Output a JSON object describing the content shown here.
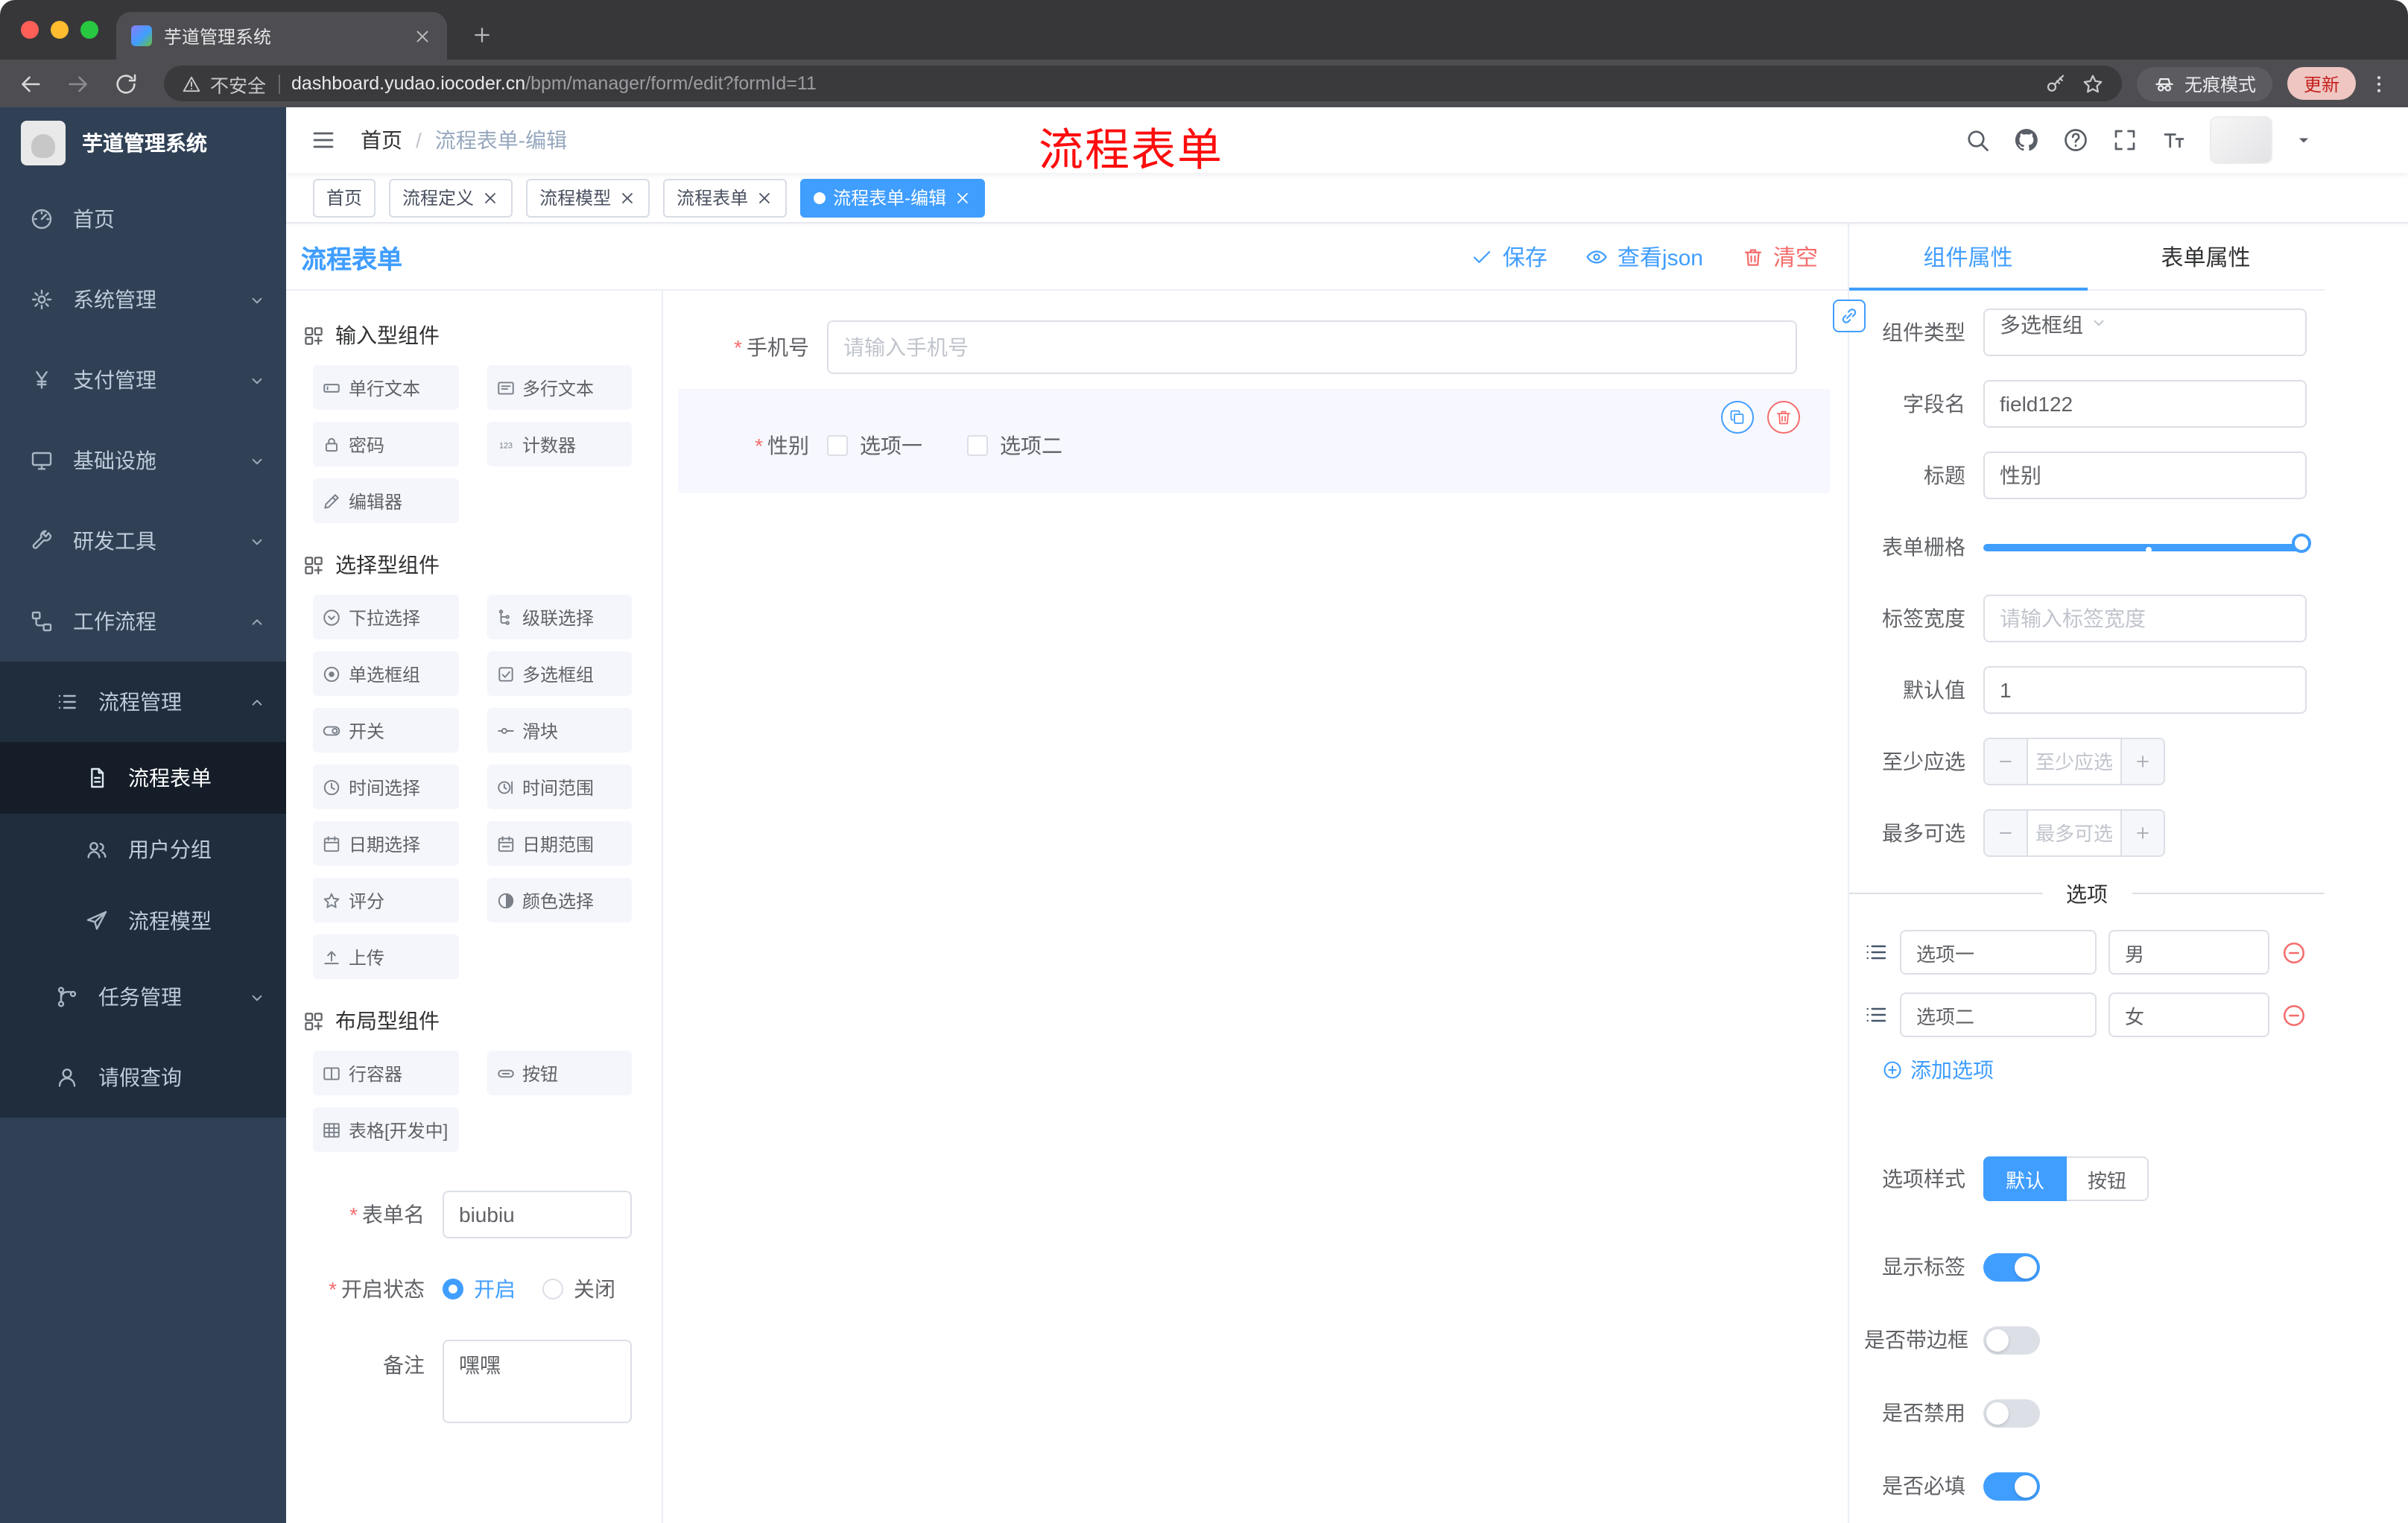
{
  "browser": {
    "tab_title": "芋道管理系统",
    "security_label": "不安全",
    "url_domain": "dashboard.yudao.iocoder.cn",
    "url_path": "/bpm/manager/form/edit?formId=11",
    "incognito_label": "无痕模式",
    "update_label": "更新"
  },
  "colors": {
    "accent": "#409eff",
    "danger": "#f56c6c",
    "sidebar_bg": "#304156",
    "annotation": "#fd0d0d"
  },
  "sidebar": {
    "logo_title": "芋道管理系统",
    "items": [
      {
        "id": "home",
        "label": "首页",
        "icon": "gauge",
        "level": 1
      },
      {
        "id": "system",
        "label": "系统管理",
        "icon": "gear",
        "level": 1,
        "chevron": "down"
      },
      {
        "id": "payment",
        "label": "支付管理",
        "icon": "yen",
        "level": 1,
        "chevron": "down"
      },
      {
        "id": "infra",
        "label": "基础设施",
        "icon": "monitor",
        "level": 1,
        "chevron": "down"
      },
      {
        "id": "devtools",
        "label": "研发工具",
        "icon": "tools",
        "level": 1,
        "chevron": "down"
      },
      {
        "id": "workflow",
        "label": "工作流程",
        "icon": "workflow",
        "level": 1,
        "chevron": "up"
      },
      {
        "id": "process-mgmt",
        "label": "流程管理",
        "icon": "list",
        "level": 2,
        "chevron": "up"
      },
      {
        "id": "process-form",
        "label": "流程表单",
        "icon": "doc",
        "level": 3,
        "active": true
      },
      {
        "id": "user-group",
        "label": "用户分组",
        "icon": "users",
        "level": 3
      },
      {
        "id": "process-model",
        "label": "流程模型",
        "icon": "send",
        "level": 3
      },
      {
        "id": "task-mgmt",
        "label": "任务管理",
        "icon": "branch",
        "level": 2,
        "chevron": "down"
      },
      {
        "id": "leave-query",
        "label": "请假查询",
        "icon": "user",
        "level": 2
      }
    ]
  },
  "header": {
    "breadcrumb_root": "首页",
    "breadcrumb_current": "流程表单-编辑",
    "annotation": "流程表单"
  },
  "tags": [
    {
      "label": "首页",
      "closable": false,
      "active": false
    },
    {
      "label": "流程定义",
      "closable": true,
      "active": false
    },
    {
      "label": "流程模型",
      "closable": true,
      "active": false
    },
    {
      "label": "流程表单",
      "closable": true,
      "active": false
    },
    {
      "label": "流程表单-编辑",
      "closable": true,
      "active": true
    }
  ],
  "designer": {
    "title": "流程表单",
    "actions": {
      "save": "保存",
      "view_json": "查看json",
      "clear": "清空"
    },
    "palette_sections": [
      {
        "title": "输入型组件",
        "items": [
          {
            "label": "单行文本",
            "icon": "input"
          },
          {
            "label": "多行文本",
            "icon": "textarea"
          },
          {
            "label": "密码",
            "icon": "lock"
          },
          {
            "label": "计数器",
            "icon": "counter"
          },
          {
            "label": "编辑器",
            "icon": "editor"
          }
        ]
      },
      {
        "title": "选择型组件",
        "items": [
          {
            "label": "下拉选择",
            "icon": "select"
          },
          {
            "label": "级联选择",
            "icon": "cascader"
          },
          {
            "label": "单选框组",
            "icon": "radio"
          },
          {
            "label": "多选框组",
            "icon": "checkbox"
          },
          {
            "label": "开关",
            "icon": "switch"
          },
          {
            "label": "滑块",
            "icon": "slider"
          },
          {
            "label": "时间选择",
            "icon": "time"
          },
          {
            "label": "时间范围",
            "icon": "time-range"
          },
          {
            "label": "日期选择",
            "icon": "date"
          },
          {
            "label": "日期范围",
            "icon": "date-range"
          },
          {
            "label": "评分",
            "icon": "rate"
          },
          {
            "label": "颜色选择",
            "icon": "color"
          },
          {
            "label": "上传",
            "icon": "upload"
          }
        ]
      },
      {
        "title": "布局型组件",
        "items": [
          {
            "label": "行容器",
            "icon": "row"
          },
          {
            "label": "按钮",
            "icon": "button"
          },
          {
            "label": "表格[开发中]",
            "icon": "table"
          }
        ]
      }
    ],
    "meta": {
      "name_label": "表单名",
      "name_value": "biubiu",
      "status_label": "开启状态",
      "status_on": "开启",
      "status_off": "关闭",
      "status_selected": "开启",
      "remark_label": "备注",
      "remark_value": "嘿嘿"
    },
    "canvas": {
      "phone_label": "手机号",
      "phone_placeholder": "请输入手机号",
      "gender_label": "性别",
      "gender_options": [
        "选项一",
        "选项二"
      ]
    }
  },
  "props": {
    "tab_component": "组件属性",
    "tab_form": "表单属性",
    "component_type_label": "组件类型",
    "component_type_value": "多选框组",
    "field_name_label": "字段名",
    "field_name_value": "field122",
    "title_label": "标题",
    "title_value": "性别",
    "grid_label": "表单栅格",
    "label_width_label": "标签宽度",
    "label_width_placeholder": "请输入标签宽度",
    "default_label": "默认值",
    "default_value": "1",
    "min_label": "至少应选",
    "min_placeholder": "至少应选",
    "max_label": "最多可选",
    "max_placeholder": "最多可选",
    "options_title": "选项",
    "options": [
      {
        "name": "选项一",
        "value": "男"
      },
      {
        "name": "选项二",
        "value": "女"
      }
    ],
    "add_option_label": "添加选项",
    "style_label": "选项样式",
    "style_default": "默认",
    "style_button": "按钮",
    "style_selected": "默认",
    "switches": [
      {
        "label": "显示标签",
        "on": true
      },
      {
        "label": "是否带边框",
        "on": false
      },
      {
        "label": "是否禁用",
        "on": false
      },
      {
        "label": "是否必填",
        "on": true
      }
    ]
  }
}
